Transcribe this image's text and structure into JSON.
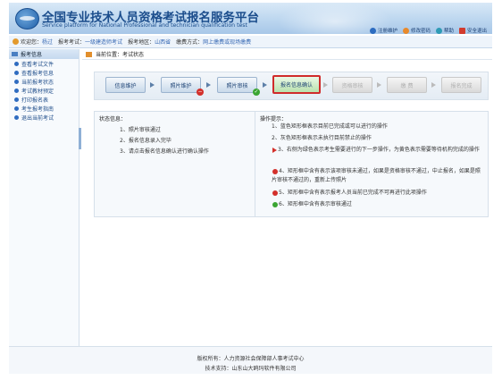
{
  "header": {
    "title_cn": "全国专业技术人员资格考试报名服务平台",
    "title_en": "Service platform for National Professional and technician qualification test",
    "links": [
      {
        "label": "注册维护",
        "icon": "register-icon"
      },
      {
        "label": "修改密码",
        "icon": "password-icon"
      },
      {
        "label": "帮助",
        "icon": "help-icon"
      },
      {
        "label": "安全退出",
        "icon": "logout-icon"
      }
    ]
  },
  "infobar": {
    "welcome_label": "欢迎您：",
    "welcome_value": "杨过",
    "exam_label": "报考考试：",
    "exam_value": "一级建造师考试",
    "region_label": "报考地区：",
    "region_value": "山西省",
    "pay_label": "缴费方式：",
    "pay_value": "网上缴费或现场缴费"
  },
  "sidebar": {
    "header": "报考信息",
    "items": [
      {
        "label": "查看考试文件"
      },
      {
        "label": "查看报考信息"
      },
      {
        "label": "当前报考状态"
      },
      {
        "label": "考试教材预定"
      },
      {
        "label": "打印报名表"
      },
      {
        "label": "考生报考指南"
      },
      {
        "label": "退出当前考试"
      }
    ]
  },
  "location": {
    "label": "当前位置：",
    "value": "考试状态"
  },
  "steps": [
    {
      "label": "信息维护",
      "state": "done"
    },
    {
      "label": "照片维护",
      "state": "error"
    },
    {
      "label": "照片审核",
      "state": "ok"
    },
    {
      "label": "报名信息确认",
      "state": "current"
    },
    {
      "label": "资格审核",
      "state": "disabled"
    },
    {
      "label": "缴 费",
      "state": "disabled"
    },
    {
      "label": "报名完成",
      "state": "disabled"
    }
  ],
  "status": {
    "title": "状态信息：",
    "lines": [
      "1、照片审核通过",
      "2、报名信息录入完毕",
      "3、请点击报名信息确认进行确认操作"
    ]
  },
  "tips": {
    "title": "操作提示：",
    "items": [
      "1、蓝色矩形框表示目前已完成或可以进行的操作",
      "2、灰色矩形框表示未执行目前禁止的操作",
      "3、右侧为绿色表示考生需要进行的下一步操作，为黄色表示需要等待机构完成的操作",
      "4、矩形框中含有表示该项审核未通过，如果是资格审核不通过，中止报名，如果是照片审核不通过的，重新上传照片",
      "5、矩形框中含有表示报考人员当前已完成不可再进行此项操作",
      "6、矩形框中含有表示审核通过"
    ]
  },
  "footer": {
    "copyright": "版权所有：人力资源社会保障部人事考试中心",
    "support": "技术支持：山东山大鸥玛软件有限公司"
  },
  "colors": {
    "brand": "#1b4d8c",
    "current_step_border": "#d02b2b",
    "error_badge": "#d3302b",
    "ok_badge": "#3aa532"
  }
}
